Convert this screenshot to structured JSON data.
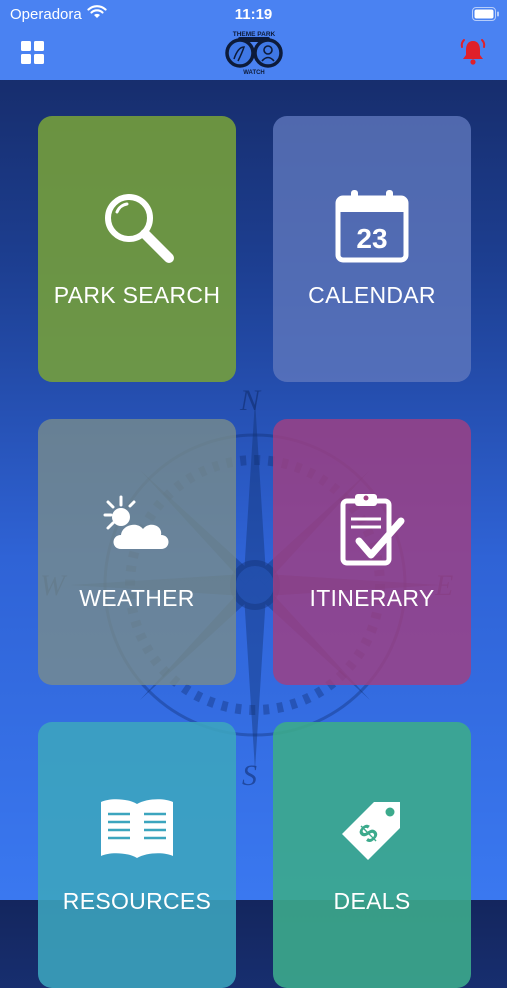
{
  "status_bar": {
    "carrier": "Operadora",
    "time": "11:19",
    "wifi_icon": "wifi-icon",
    "battery_icon": "battery-icon"
  },
  "header": {
    "menu_icon": "grid-menu-icon",
    "logo_top_text": "THEME PARK",
    "logo_bottom_text": "WATCH",
    "notification_icon": "bell-icon",
    "accent_color": "#4a82f2",
    "bell_color": "#e0202a"
  },
  "background": {
    "compass_letters": {
      "north": "N",
      "south": "S",
      "east": "E",
      "west": "W"
    }
  },
  "tiles": [
    {
      "label": "PARK SEARCH",
      "icon": "magnifier-icon",
      "color": "#76a03a"
    },
    {
      "label": "CALENDAR",
      "icon": "calendar-icon",
      "calendar_day": "23",
      "color": "#6078be"
    },
    {
      "label": "WEATHER",
      "icon": "sun-cloud-icon",
      "color": "#788c8c"
    },
    {
      "label": "ITINERARY",
      "icon": "clipboard-check-icon",
      "color": "#a04082"
    },
    {
      "label": "RESOURCES",
      "icon": "open-book-icon",
      "color": "#3ca5be"
    },
    {
      "label": "DEALS",
      "icon": "price-tag-icon",
      "color": "#3caa8c"
    }
  ]
}
